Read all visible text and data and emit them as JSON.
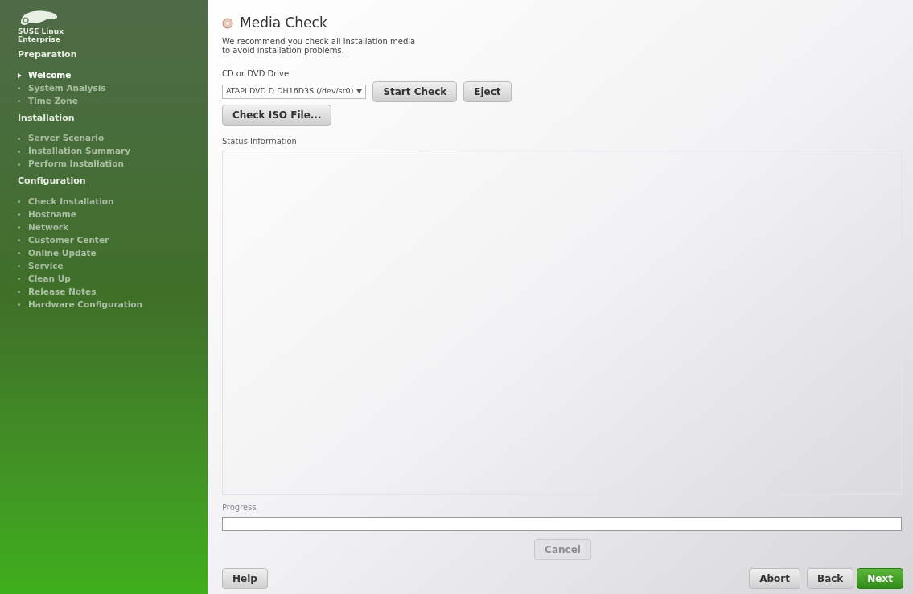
{
  "sidebar": {
    "brand": [
      "SUSE Linux",
      "Enterprise"
    ],
    "sections": [
      {
        "title": "Preparation",
        "items": [
          {
            "label": "Welcome",
            "selected": true
          },
          {
            "label": "System Analysis",
            "selected": false
          },
          {
            "label": "Time Zone",
            "selected": false
          }
        ]
      },
      {
        "title": "Installation",
        "items": [
          {
            "label": "Server Scenario",
            "selected": false
          },
          {
            "label": "Installation Summary",
            "selected": false
          },
          {
            "label": "Perform Installation",
            "selected": false
          }
        ]
      },
      {
        "title": "Configuration",
        "items": [
          {
            "label": "Check Installation",
            "selected": false
          },
          {
            "label": "Hostname",
            "selected": false
          },
          {
            "label": "Network",
            "selected": false
          },
          {
            "label": "Customer Center",
            "selected": false
          },
          {
            "label": "Online Update",
            "selected": false
          },
          {
            "label": "Service",
            "selected": false
          },
          {
            "label": "Clean Up",
            "selected": false
          },
          {
            "label": "Release Notes",
            "selected": false
          },
          {
            "label": "Hardware Configuration",
            "selected": false
          }
        ]
      }
    ]
  },
  "main": {
    "title": "Media Check",
    "description": [
      "We recommend you check all installation media",
      "to avoid installation problems."
    ],
    "drive_label": "CD or DVD Drive",
    "drive_value": "ATAPI DVD D  DH16D3S (/dev/sr0)",
    "buttons": [
      {
        "label": "Start Check",
        "disabled": false
      },
      {
        "label": "Eject",
        "disabled": false
      }
    ],
    "iso_button": "Check ISO File...",
    "status_label": "Status Information",
    "progress": {
      "label": "Progress",
      "level": 0
    },
    "cancel": {
      "label": "Cancel",
      "disabled": true
    }
  },
  "footer": {
    "help": "Help",
    "abort": "Abort",
    "back": "Back",
    "next": "Next"
  }
}
